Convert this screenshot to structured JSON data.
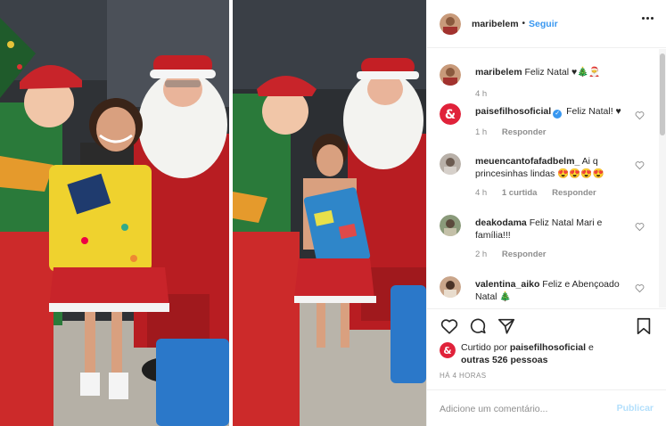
{
  "post": {
    "username": "maribelem",
    "separator": "•",
    "follow_label": "Seguir",
    "more_icon": "more-options-icon",
    "caption": {
      "username": "maribelem",
      "text": "Feliz Natal ♥🎄🎅",
      "time": "4 h"
    }
  },
  "comments": [
    {
      "username": "paisefilhosoficial",
      "verified": true,
      "text": "Feliz Natal! ♥",
      "time": "1 h",
      "likes": "",
      "reply_label": "Responder",
      "avatar_color": "#e0223a"
    },
    {
      "username": "meuencantofafadbelm_",
      "verified": false,
      "text": "Ai q princesinhas lindas 😍😍😍😍",
      "time": "4 h",
      "likes": "1 curtida",
      "reply_label": "Responder",
      "avatar_color": "#b8b0a8"
    },
    {
      "username": "deakodama",
      "verified": false,
      "text": "Feliz Natal Mari e família!!!",
      "time": "2 h",
      "likes": "",
      "reply_label": "Responder",
      "avatar_color": "#8a9a7a"
    },
    {
      "username": "valentina_aiko",
      "verified": false,
      "text": "Feliz e Abençoado Natal 🎄",
      "time": "",
      "likes": "",
      "reply_label": "",
      "avatar_color": "#c9a58a"
    }
  ],
  "actions": {
    "like_icon": "heart-icon",
    "comment_icon": "comment-icon",
    "share_icon": "share-icon",
    "save_icon": "bookmark-icon"
  },
  "likes": {
    "prefix": "Curtido por",
    "user": "paisefilhosoficial",
    "and": "e",
    "others": "outras 526 pessoas"
  },
  "timestamp": "HÁ 4 HORAS",
  "composer": {
    "placeholder": "Adicione um comentário...",
    "post_label": "Publicar"
  },
  "colors": {
    "link": "#3897f0",
    "muted": "#8e8e8e",
    "publish_disabled": "#b2dffc",
    "brand_red": "#e0223a"
  }
}
